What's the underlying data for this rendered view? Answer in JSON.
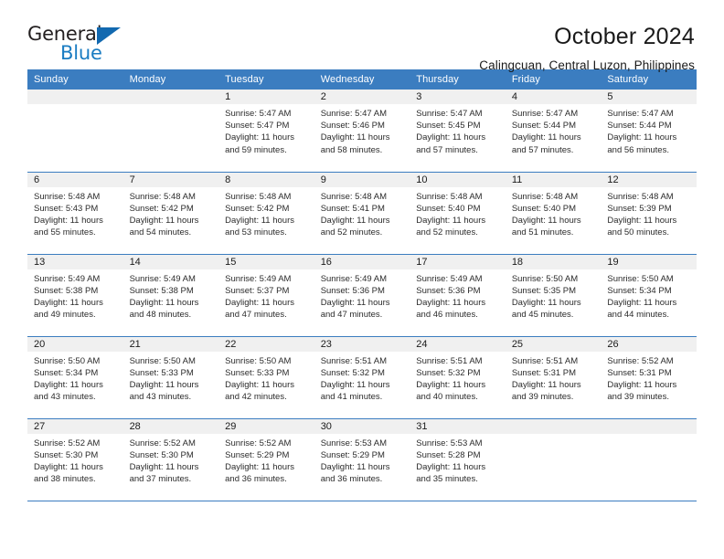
{
  "brand": {
    "name_top": "General",
    "name_bottom": "Blue",
    "accent_color": "#1a7cc2",
    "triangle_color": "#1269b0"
  },
  "header": {
    "title": "October 2024",
    "subtitle": "Calingcuan, Central Luzon, Philippines"
  },
  "theme": {
    "header_row_bg": "#3b7dc0",
    "header_row_text": "#ffffff",
    "daynum_band_bg": "#f0f0f0",
    "cell_bg": "#ffffff",
    "row_divider": "#3b7dc0"
  },
  "weekday_headers": [
    "Sunday",
    "Monday",
    "Tuesday",
    "Wednesday",
    "Thursday",
    "Friday",
    "Saturday"
  ],
  "labels": {
    "sunrise_prefix": "Sunrise:",
    "sunset_prefix": "Sunset:",
    "daylight_prefix": "Daylight:"
  },
  "weeks": [
    [
      {
        "day": "",
        "empty": true
      },
      {
        "day": "",
        "empty": true
      },
      {
        "day": "1",
        "sunrise": "Sunrise: 5:47 AM",
        "sunset": "Sunset: 5:47 PM",
        "daylight_l1": "Daylight: 11 hours",
        "daylight_l2": "and 59 minutes."
      },
      {
        "day": "2",
        "sunrise": "Sunrise: 5:47 AM",
        "sunset": "Sunset: 5:46 PM",
        "daylight_l1": "Daylight: 11 hours",
        "daylight_l2": "and 58 minutes."
      },
      {
        "day": "3",
        "sunrise": "Sunrise: 5:47 AM",
        "sunset": "Sunset: 5:45 PM",
        "daylight_l1": "Daylight: 11 hours",
        "daylight_l2": "and 57 minutes."
      },
      {
        "day": "4",
        "sunrise": "Sunrise: 5:47 AM",
        "sunset": "Sunset: 5:44 PM",
        "daylight_l1": "Daylight: 11 hours",
        "daylight_l2": "and 57 minutes."
      },
      {
        "day": "5",
        "sunrise": "Sunrise: 5:47 AM",
        "sunset": "Sunset: 5:44 PM",
        "daylight_l1": "Daylight: 11 hours",
        "daylight_l2": "and 56 minutes."
      }
    ],
    [
      {
        "day": "6",
        "sunrise": "Sunrise: 5:48 AM",
        "sunset": "Sunset: 5:43 PM",
        "daylight_l1": "Daylight: 11 hours",
        "daylight_l2": "and 55 minutes."
      },
      {
        "day": "7",
        "sunrise": "Sunrise: 5:48 AM",
        "sunset": "Sunset: 5:42 PM",
        "daylight_l1": "Daylight: 11 hours",
        "daylight_l2": "and 54 minutes."
      },
      {
        "day": "8",
        "sunrise": "Sunrise: 5:48 AM",
        "sunset": "Sunset: 5:42 PM",
        "daylight_l1": "Daylight: 11 hours",
        "daylight_l2": "and 53 minutes."
      },
      {
        "day": "9",
        "sunrise": "Sunrise: 5:48 AM",
        "sunset": "Sunset: 5:41 PM",
        "daylight_l1": "Daylight: 11 hours",
        "daylight_l2": "and 52 minutes."
      },
      {
        "day": "10",
        "sunrise": "Sunrise: 5:48 AM",
        "sunset": "Sunset: 5:40 PM",
        "daylight_l1": "Daylight: 11 hours",
        "daylight_l2": "and 52 minutes."
      },
      {
        "day": "11",
        "sunrise": "Sunrise: 5:48 AM",
        "sunset": "Sunset: 5:40 PM",
        "daylight_l1": "Daylight: 11 hours",
        "daylight_l2": "and 51 minutes."
      },
      {
        "day": "12",
        "sunrise": "Sunrise: 5:48 AM",
        "sunset": "Sunset: 5:39 PM",
        "daylight_l1": "Daylight: 11 hours",
        "daylight_l2": "and 50 minutes."
      }
    ],
    [
      {
        "day": "13",
        "sunrise": "Sunrise: 5:49 AM",
        "sunset": "Sunset: 5:38 PM",
        "daylight_l1": "Daylight: 11 hours",
        "daylight_l2": "and 49 minutes."
      },
      {
        "day": "14",
        "sunrise": "Sunrise: 5:49 AM",
        "sunset": "Sunset: 5:38 PM",
        "daylight_l1": "Daylight: 11 hours",
        "daylight_l2": "and 48 minutes."
      },
      {
        "day": "15",
        "sunrise": "Sunrise: 5:49 AM",
        "sunset": "Sunset: 5:37 PM",
        "daylight_l1": "Daylight: 11 hours",
        "daylight_l2": "and 47 minutes."
      },
      {
        "day": "16",
        "sunrise": "Sunrise: 5:49 AM",
        "sunset": "Sunset: 5:36 PM",
        "daylight_l1": "Daylight: 11 hours",
        "daylight_l2": "and 47 minutes."
      },
      {
        "day": "17",
        "sunrise": "Sunrise: 5:49 AM",
        "sunset": "Sunset: 5:36 PM",
        "daylight_l1": "Daylight: 11 hours",
        "daylight_l2": "and 46 minutes."
      },
      {
        "day": "18",
        "sunrise": "Sunrise: 5:50 AM",
        "sunset": "Sunset: 5:35 PM",
        "daylight_l1": "Daylight: 11 hours",
        "daylight_l2": "and 45 minutes."
      },
      {
        "day": "19",
        "sunrise": "Sunrise: 5:50 AM",
        "sunset": "Sunset: 5:34 PM",
        "daylight_l1": "Daylight: 11 hours",
        "daylight_l2": "and 44 minutes."
      }
    ],
    [
      {
        "day": "20",
        "sunrise": "Sunrise: 5:50 AM",
        "sunset": "Sunset: 5:34 PM",
        "daylight_l1": "Daylight: 11 hours",
        "daylight_l2": "and 43 minutes."
      },
      {
        "day": "21",
        "sunrise": "Sunrise: 5:50 AM",
        "sunset": "Sunset: 5:33 PM",
        "daylight_l1": "Daylight: 11 hours",
        "daylight_l2": "and 43 minutes."
      },
      {
        "day": "22",
        "sunrise": "Sunrise: 5:50 AM",
        "sunset": "Sunset: 5:33 PM",
        "daylight_l1": "Daylight: 11 hours",
        "daylight_l2": "and 42 minutes."
      },
      {
        "day": "23",
        "sunrise": "Sunrise: 5:51 AM",
        "sunset": "Sunset: 5:32 PM",
        "daylight_l1": "Daylight: 11 hours",
        "daylight_l2": "and 41 minutes."
      },
      {
        "day": "24",
        "sunrise": "Sunrise: 5:51 AM",
        "sunset": "Sunset: 5:32 PM",
        "daylight_l1": "Daylight: 11 hours",
        "daylight_l2": "and 40 minutes."
      },
      {
        "day": "25",
        "sunrise": "Sunrise: 5:51 AM",
        "sunset": "Sunset: 5:31 PM",
        "daylight_l1": "Daylight: 11 hours",
        "daylight_l2": "and 39 minutes."
      },
      {
        "day": "26",
        "sunrise": "Sunrise: 5:52 AM",
        "sunset": "Sunset: 5:31 PM",
        "daylight_l1": "Daylight: 11 hours",
        "daylight_l2": "and 39 minutes."
      }
    ],
    [
      {
        "day": "27",
        "sunrise": "Sunrise: 5:52 AM",
        "sunset": "Sunset: 5:30 PM",
        "daylight_l1": "Daylight: 11 hours",
        "daylight_l2": "and 38 minutes."
      },
      {
        "day": "28",
        "sunrise": "Sunrise: 5:52 AM",
        "sunset": "Sunset: 5:30 PM",
        "daylight_l1": "Daylight: 11 hours",
        "daylight_l2": "and 37 minutes."
      },
      {
        "day": "29",
        "sunrise": "Sunrise: 5:52 AM",
        "sunset": "Sunset: 5:29 PM",
        "daylight_l1": "Daylight: 11 hours",
        "daylight_l2": "and 36 minutes."
      },
      {
        "day": "30",
        "sunrise": "Sunrise: 5:53 AM",
        "sunset": "Sunset: 5:29 PM",
        "daylight_l1": "Daylight: 11 hours",
        "daylight_l2": "and 36 minutes."
      },
      {
        "day": "31",
        "sunrise": "Sunrise: 5:53 AM",
        "sunset": "Sunset: 5:28 PM",
        "daylight_l1": "Daylight: 11 hours",
        "daylight_l2": "and 35 minutes."
      },
      {
        "day": "",
        "empty": true
      },
      {
        "day": "",
        "empty": true
      }
    ]
  ]
}
